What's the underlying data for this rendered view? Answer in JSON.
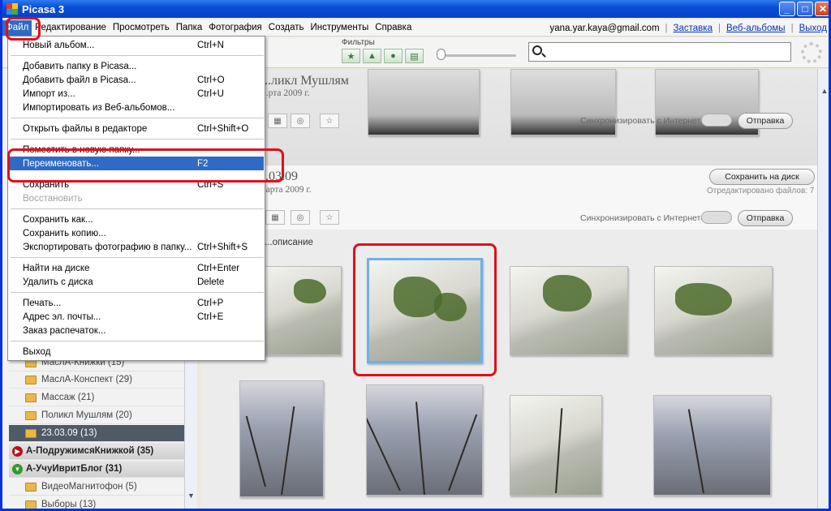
{
  "window": {
    "title": "Picasa 3"
  },
  "menubar": {
    "items": [
      "Файл",
      "Редактирование",
      "Просмотреть",
      "Папка",
      "Фотография",
      "Создать",
      "Инструменты",
      "Справка"
    ],
    "account_email": "yana.yar.kaya@gmail.com",
    "links": [
      "Заставка",
      "Веб-альбомы",
      "Выход"
    ]
  },
  "toolbar": {
    "filters_label": "Фильтры",
    "search_placeholder": ""
  },
  "file_menu": {
    "items": [
      {
        "label": "Новый альбом...",
        "shortcut": "Ctrl+N"
      },
      {
        "label": "Добавить папку в Picasa...",
        "shortcut": ""
      },
      {
        "label": "Добавить файл в Picasa...",
        "shortcut": "Ctrl+O"
      },
      {
        "label": "Импорт из...",
        "shortcut": "Ctrl+U"
      },
      {
        "label": "Импортировать из Веб-альбомов...",
        "shortcut": ""
      },
      {
        "label": "Открыть файлы в редакторе",
        "shortcut": "Ctrl+Shift+O"
      },
      {
        "label": "Поместить в новую папку...",
        "shortcut": ""
      },
      {
        "label": "Переименовать...",
        "shortcut": "F2"
      },
      {
        "label": "Сохранить",
        "shortcut": "Ctrl+S"
      },
      {
        "label": "Восстановить",
        "shortcut": ""
      },
      {
        "label": "Сохранить как...",
        "shortcut": ""
      },
      {
        "label": "Сохранить копию...",
        "shortcut": ""
      },
      {
        "label": "Экспортировать фотографию в папку...",
        "shortcut": "Ctrl+Shift+S"
      },
      {
        "label": "Найти на диске",
        "shortcut": "Ctrl+Enter"
      },
      {
        "label": "Удалить с диска",
        "shortcut": "Delete"
      },
      {
        "label": "Печать...",
        "shortcut": "Ctrl+P"
      },
      {
        "label": "Адрес эл. почты...",
        "shortcut": "Ctrl+E"
      },
      {
        "label": "Заказ распечаток...",
        "shortcut": ""
      },
      {
        "label": "Выход",
        "shortcut": ""
      }
    ]
  },
  "left_panel": {
    "rows": [
      {
        "label": "МаслА-Книжки (15)",
        "kind": "folder"
      },
      {
        "label": "МаслА-Конспект (29)",
        "kind": "folder"
      },
      {
        "label": "Массаж (21)",
        "kind": "folder"
      },
      {
        "label": "Поликл Мушлям (20)",
        "kind": "folder"
      },
      {
        "label": "23.03.09 (13)",
        "kind": "folder-selected"
      },
      {
        "label": "А-ПодружимсяКнижкой (35)",
        "kind": "group-collapsed"
      },
      {
        "label": "А-УчуИвритБлог (31)",
        "kind": "group-expanded"
      },
      {
        "label": "ВидеоМагнитофон (5)",
        "kind": "folder"
      },
      {
        "label": "Выборы (13)",
        "kind": "folder"
      }
    ]
  },
  "albums": [
    {
      "title": "...ликл Мушлям",
      "date": "...рта 2009 г.",
      "sync_label": "Синхронизировать с Интернетом",
      "send_label": "Отправка"
    },
    {
      "title": "...03.09",
      "date": "...арта 2009 г.",
      "save_label": "Сохранить на диск",
      "edited_label": "Отредактировано файлов: 7",
      "sync_label": "Синхронизировать с Интернетом",
      "send_label": "Отправка",
      "description_label": "...описание"
    }
  ],
  "colors": {
    "selection": "#316ac5",
    "highlight_box": "#e0101a",
    "title_bar": "#0a4ed8"
  }
}
